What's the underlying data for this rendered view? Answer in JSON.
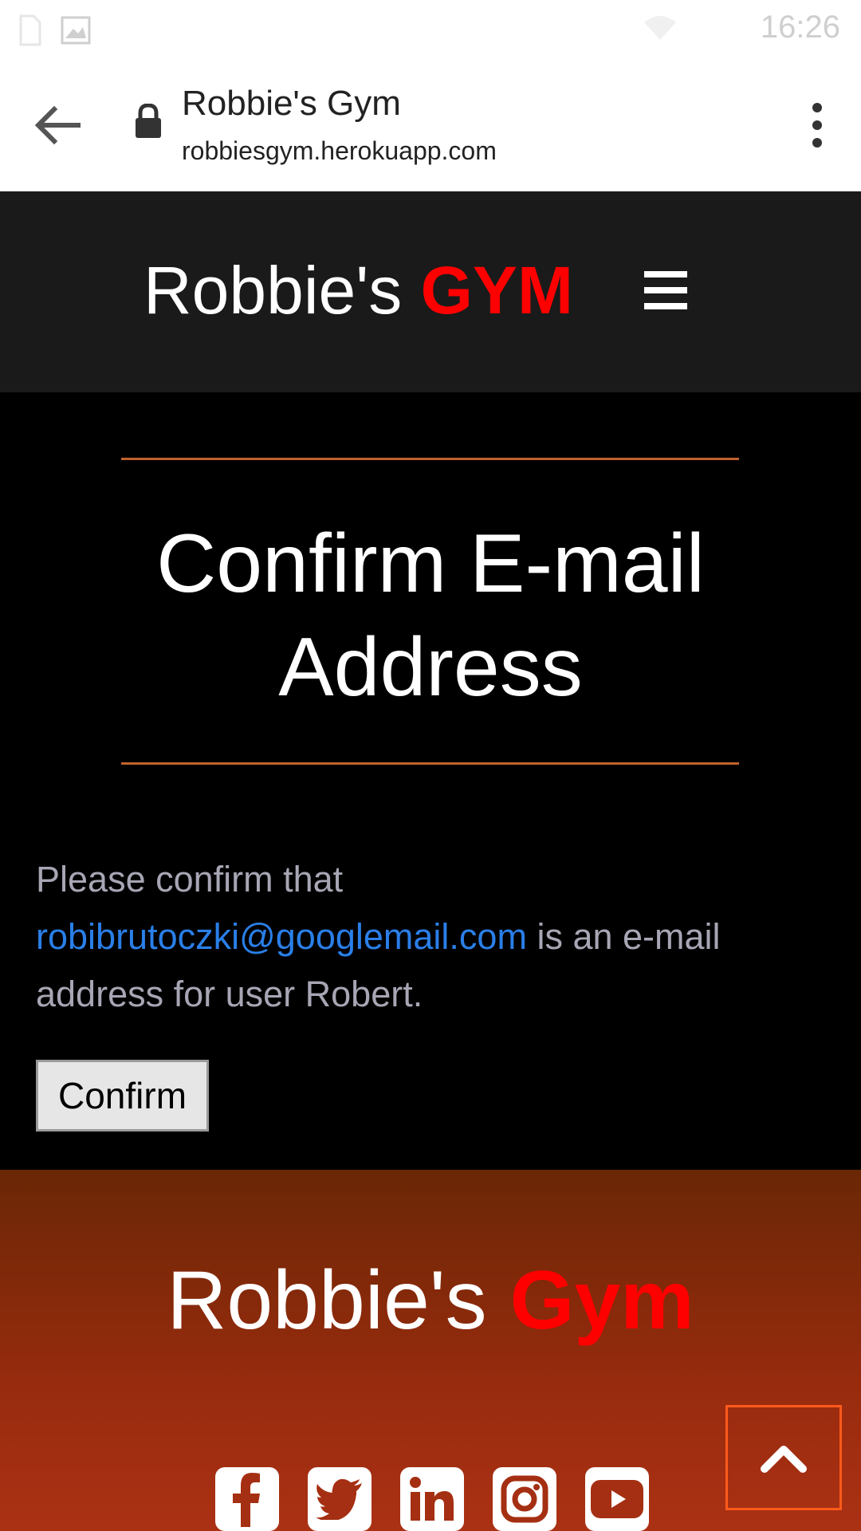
{
  "status_bar": {
    "time": "16:26",
    "icons": [
      "sim-icon",
      "image-icon",
      "wifi-icon"
    ]
  },
  "browser": {
    "page_title": "Robbie's Gym",
    "url": "robbiesgym.herokuapp.com"
  },
  "header": {
    "brand_main": "Robbie's",
    "brand_accent": "GYM"
  },
  "main": {
    "heading_line1": "Confirm E-mail",
    "heading_line2": "Address",
    "message_prefix": "Please confirm that",
    "email": "robibrutoczki@googlemail.com",
    "message_suffix": "is an e-mail address for user Robert.",
    "confirm_label": "Confirm"
  },
  "footer": {
    "brand_main": "Robbie's",
    "brand_accent": "Gym",
    "social": [
      "facebook-icon",
      "twitter-icon",
      "linkedin-icon",
      "instagram-icon",
      "youtube-icon"
    ]
  },
  "colors": {
    "accent_red": "#ff0000",
    "divider": "#c0622c",
    "link": "#2a7fe8",
    "header_bg": "#1a1a1a"
  }
}
